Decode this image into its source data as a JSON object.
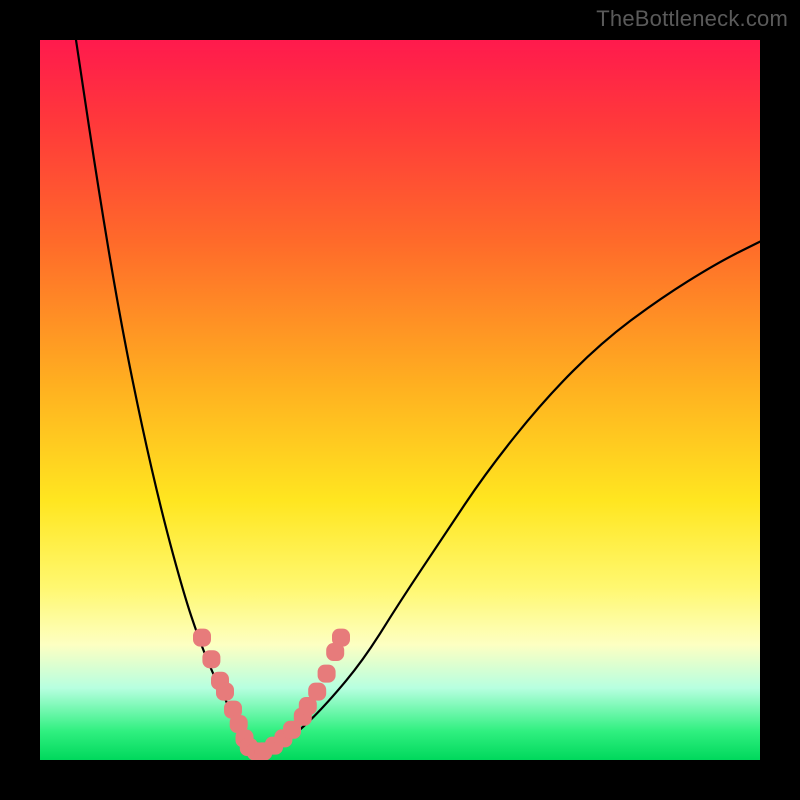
{
  "watermark": "TheBottleneck.com",
  "chart_data": {
    "type": "line",
    "title": "",
    "xlabel": "",
    "ylabel": "",
    "xlim": [
      0,
      100
    ],
    "ylim": [
      0,
      100
    ],
    "grid": false,
    "series": [
      {
        "name": "curve",
        "color": "#000000",
        "x": [
          5,
          8,
          11,
          14,
          17,
          20,
          22,
          24,
          26,
          27,
          28,
          29,
          30,
          31,
          33,
          36,
          40,
          45,
          50,
          56,
          62,
          70,
          78,
          86,
          94,
          100
        ],
        "y": [
          100,
          80,
          62,
          47,
          34,
          23,
          17,
          12,
          8,
          5,
          3,
          1.5,
          1,
          1.2,
          2,
          4,
          8,
          14,
          22,
          31,
          40,
          50,
          58,
          64,
          69,
          72
        ]
      },
      {
        "name": "markers",
        "color": "#e77b7b",
        "type": "scatter",
        "x": [
          22.5,
          23.8,
          25.0,
          25.7,
          26.8,
          27.6,
          28.4,
          29.0,
          30.0,
          31.0,
          32.5,
          33.8,
          35.0,
          36.5,
          37.2,
          38.5,
          39.8,
          41.0,
          41.8
        ],
        "y": [
          17,
          14,
          11,
          9.5,
          7,
          5,
          3,
          1.8,
          1.2,
          1.2,
          2,
          3,
          4.2,
          6,
          7.5,
          9.5,
          12,
          15,
          17
        ]
      }
    ],
    "background_gradient": {
      "direction": "vertical",
      "stops": [
        {
          "pos": 0.0,
          "color": "#ff1a4d"
        },
        {
          "pos": 0.12,
          "color": "#ff3a3a"
        },
        {
          "pos": 0.28,
          "color": "#ff6a2a"
        },
        {
          "pos": 0.48,
          "color": "#ffb020"
        },
        {
          "pos": 0.64,
          "color": "#ffe620"
        },
        {
          "pos": 0.76,
          "color": "#fff870"
        },
        {
          "pos": 0.84,
          "color": "#fdffc2"
        },
        {
          "pos": 0.9,
          "color": "#b7ffe0"
        },
        {
          "pos": 0.96,
          "color": "#30f080"
        },
        {
          "pos": 1.0,
          "color": "#00d85c"
        }
      ]
    }
  }
}
